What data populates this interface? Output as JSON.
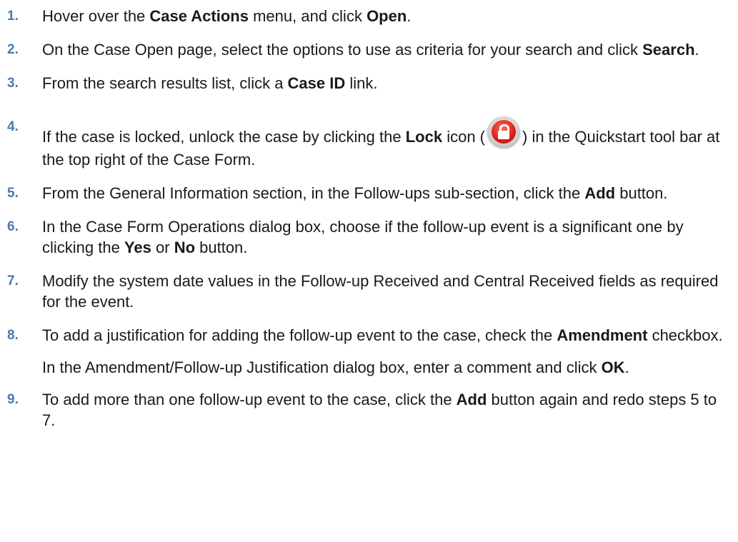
{
  "steps": [
    {
      "num": "1.",
      "parts": [
        "Hover over the ",
        "Case Actions",
        " menu, and click ",
        "Open",
        "."
      ]
    },
    {
      "num": "2.",
      "parts": [
        "On the Case Open page, select the options to use as criteria for your search and click ",
        "Search",
        "."
      ]
    },
    {
      "num": "3.",
      "parts": [
        "From the search results list, click a ",
        "Case ID",
        " link."
      ]
    },
    {
      "num": "4.",
      "parts": [
        "If the case is locked, unlock the case by clicking the ",
        "Lock",
        " icon (",
        ") in the Quickstart tool bar at the top right of the Case Form."
      ]
    },
    {
      "num": "5.",
      "parts": [
        "From the General Information section, in the Follow-ups sub-section, click the ",
        "Add",
        " button."
      ]
    },
    {
      "num": "6.",
      "parts": [
        "In the Case Form Operations dialog box, choose if the follow-up event is a significant one by clicking the ",
        "Yes",
        " or ",
        "No",
        " button."
      ]
    },
    {
      "num": "7.",
      "parts": [
        "Modify the system date values in the Follow-up Received and Central Received fields as required for the event."
      ]
    },
    {
      "num": "8.",
      "parts": [
        "To add a justification for adding the follow-up event to the case, check the ",
        "Amendment",
        " checkbox."
      ],
      "sub": [
        "In the Amendment/Follow-up Justification dialog box, enter a comment and click ",
        "OK",
        "."
      ]
    },
    {
      "num": "9.",
      "parts": [
        "To add more than one follow-up event to the case, click the ",
        "Add",
        " button again and redo steps 5 to 7."
      ]
    }
  ],
  "icons": {
    "lock": "lock-icon"
  },
  "colors": {
    "step_number": "#4a7ab0",
    "text": "#1a1a1a"
  }
}
